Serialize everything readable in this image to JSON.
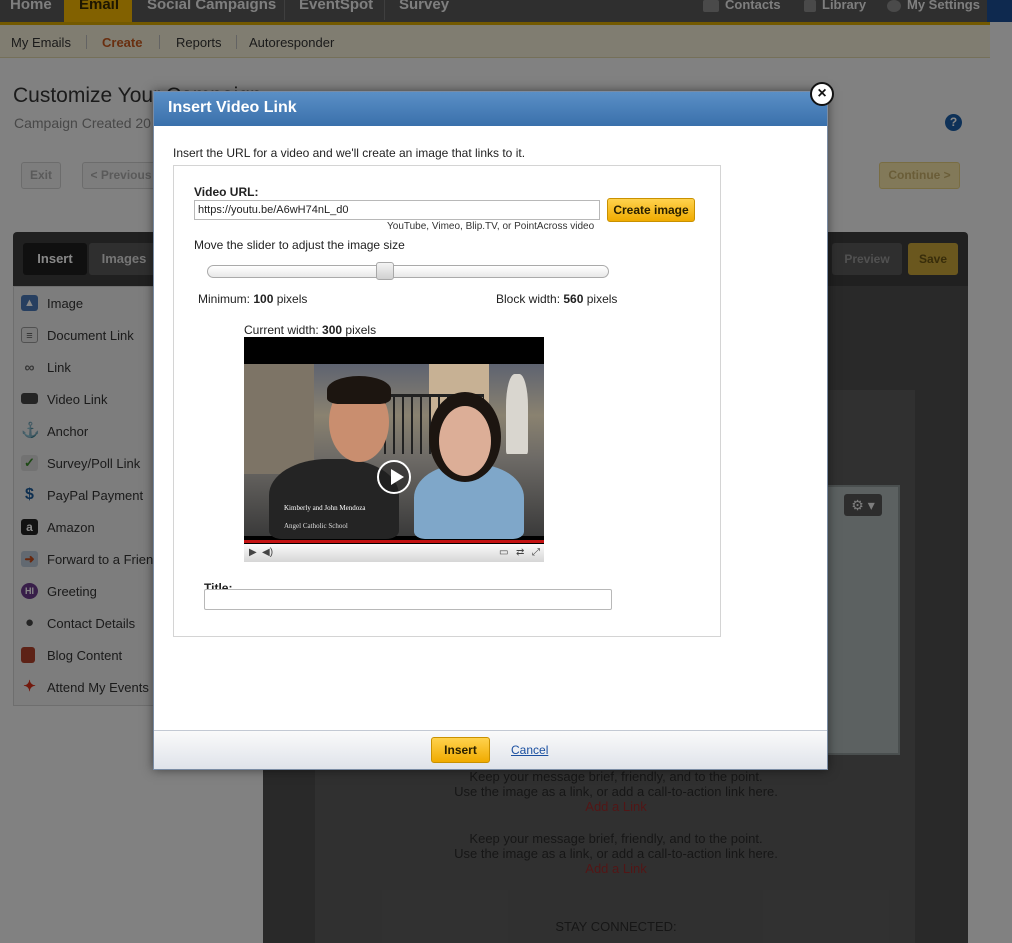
{
  "topnav": {
    "tabs": [
      "Home",
      "Email",
      "Social Campaigns",
      "EventSpot",
      "Survey"
    ],
    "right": [
      "Contacts",
      "Library",
      "My Settings"
    ]
  },
  "subnav": [
    "My Emails",
    "Create",
    "Reports",
    "Autoresponder"
  ],
  "page": {
    "title": "Customize Your Campaign",
    "subtitle": "Campaign Created 20",
    "help": "?"
  },
  "actions": {
    "exit": "Exit",
    "previous": "< Previous",
    "continue": "Continue >"
  },
  "editor": {
    "tab_insert": "Insert",
    "tab_images": "Images",
    "preview": "Preview",
    "save": "Save"
  },
  "sidebar": {
    "items": [
      {
        "label": "Image",
        "icon": "image-icon"
      },
      {
        "label": "Document Link",
        "icon": "document-icon"
      },
      {
        "label": "Link",
        "icon": "chain-link-icon"
      },
      {
        "label": "Video Link",
        "icon": "video-camera-icon"
      },
      {
        "label": "Anchor",
        "icon": "anchor-icon"
      },
      {
        "label": "Survey/Poll Link",
        "icon": "checkmark-icon"
      },
      {
        "label": "PayPal Payment",
        "icon": "dollar-icon"
      },
      {
        "label": "Amazon",
        "icon": "amazon-icon"
      },
      {
        "label": "Forward to a Friend",
        "icon": "forward-icon"
      },
      {
        "label": "Greeting",
        "icon": "greeting-hi-icon"
      },
      {
        "label": "Contact Details",
        "icon": "person-icon"
      },
      {
        "label": "Blog Content",
        "icon": "book-icon"
      },
      {
        "label": "Attend My Events",
        "icon": "events-icon"
      }
    ]
  },
  "canvas": {
    "body_line1": "Keep your message brief, friendly, and to the point.",
    "body_line2": "Use the image as a link, or add a call-to-action link here.",
    "add_link": "Add a Link",
    "stay_connected": "STAY CONNECTED:"
  },
  "modal": {
    "title": "Insert Video Link",
    "intro": "Insert the URL for a video and we'll create an image that links to it.",
    "url_label": "Video URL:",
    "url_value": "https://youtu.be/A6wH74nL_d0",
    "create_button": "Create image",
    "providers": "YouTube, Vimeo, Blip.TV, or PointAcross video",
    "slider_label": "Move the slider to adjust the image size",
    "slider_position": 0.44,
    "min_prefix": "Minimum: ",
    "min_value": "100",
    "min_suffix": " pixels",
    "block_prefix": "Block width: ",
    "block_value": "560",
    "block_suffix": " pixels",
    "current_prefix": "Current width: ",
    "current_value": "300",
    "current_suffix": " pixels",
    "video_caption": "Kimberly and John Mendoza",
    "video_caption2": "Angel Catholic School",
    "title_label": "Title:",
    "title_value": "",
    "insert_button": "Insert",
    "cancel_link": "Cancel"
  },
  "colors": {
    "nav_active": "#f5b800",
    "modal_header": "#3a70ab",
    "button_yellow": "#f0ab00",
    "link_blue": "#1a4fa0"
  }
}
